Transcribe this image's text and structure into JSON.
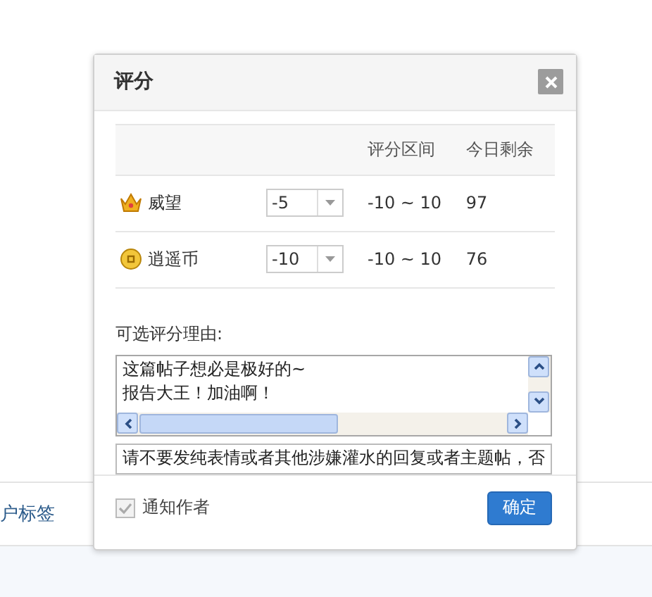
{
  "background": {
    "tag_link": "户标签"
  },
  "dialog": {
    "title": "评分",
    "table": {
      "columns": [
        "评分区间",
        "今日剩余"
      ],
      "rows": [
        {
          "kind": "crown",
          "name": "威望",
          "score": "-5",
          "range": "-10 ~ 10",
          "remaining": "97"
        },
        {
          "kind": "coin",
          "name": "逍遥币",
          "score": "-10",
          "range": "-10 ~ 10",
          "remaining": "76"
        }
      ]
    },
    "reason_label": "可选评分理由:",
    "reasons": [
      "这篇帖子想必是极好的~",
      "报告大王！加油啊！"
    ],
    "reason_input": "请不要发纯表情或者其他涉嫌灌水的回复或者主题帖，否",
    "notify": {
      "label": "通知作者",
      "checked": true
    },
    "submit": "确定"
  }
}
